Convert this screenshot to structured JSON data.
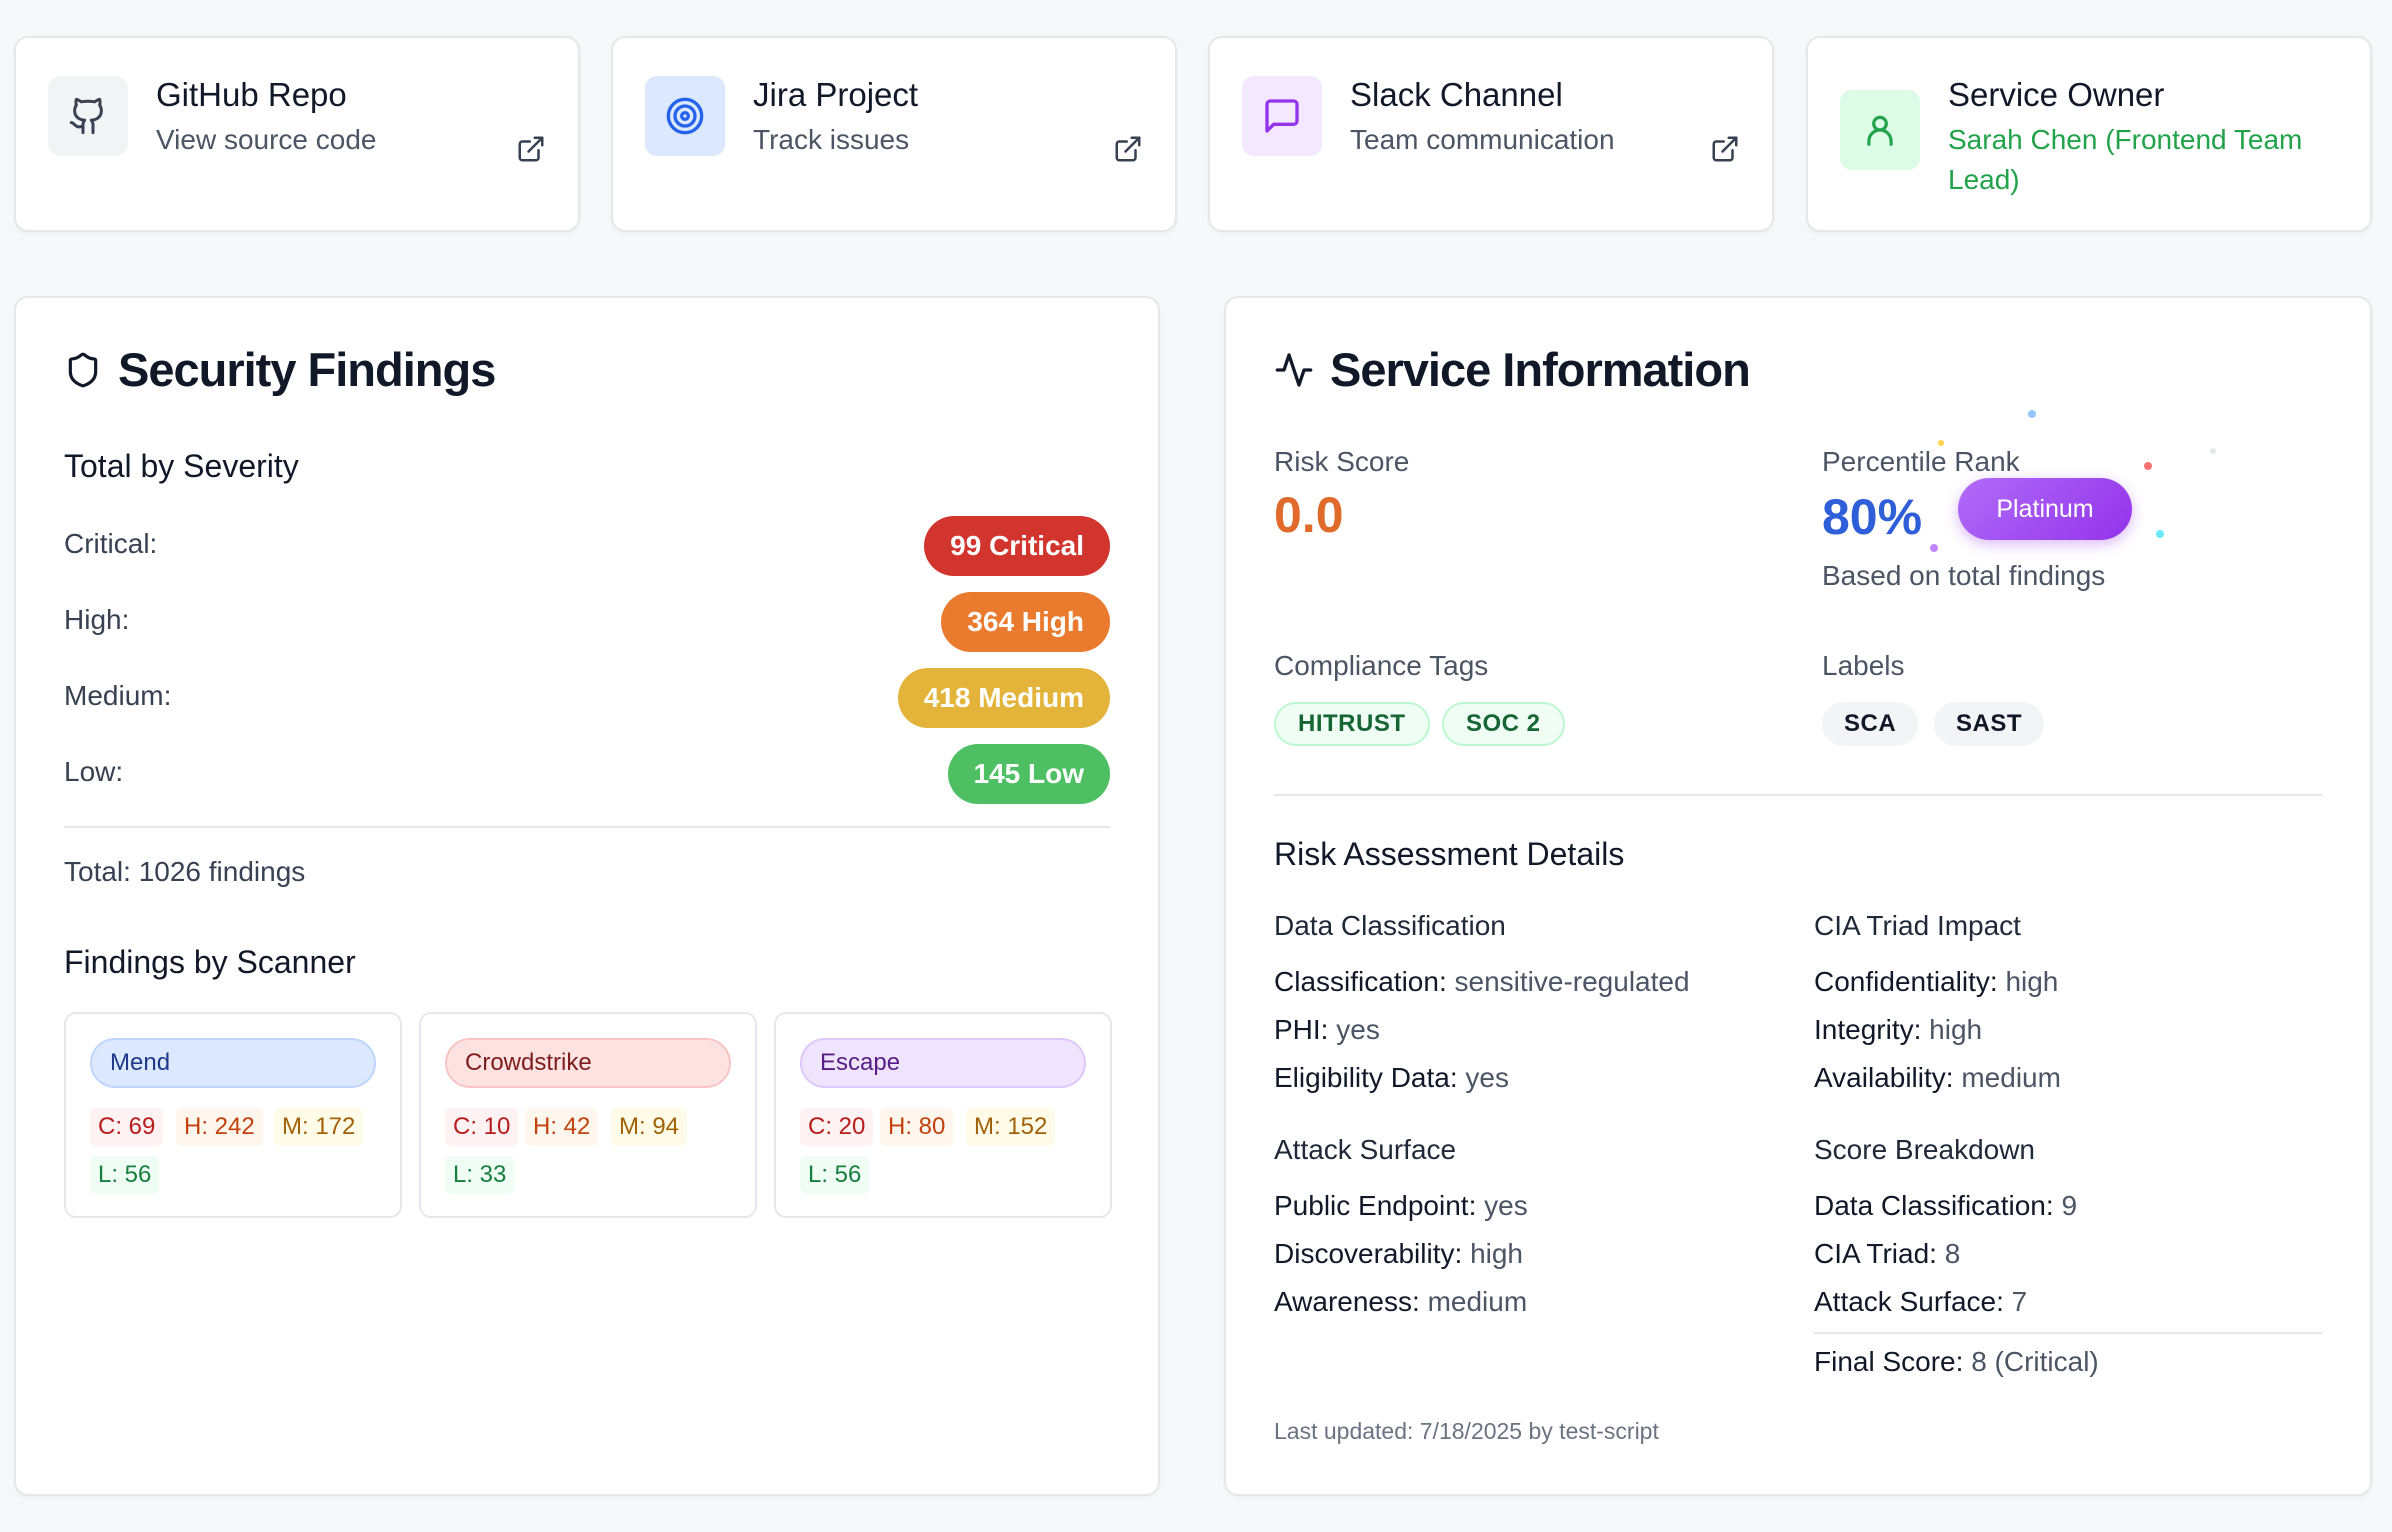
{
  "links": [
    {
      "title": "GitHub Repo",
      "subtitle": "View source code",
      "icon": "github-icon",
      "color": "#374151"
    },
    {
      "title": "Jira Project",
      "subtitle": "Track issues",
      "icon": "target-icon",
      "color": "#2563eb"
    },
    {
      "title": "Slack Channel",
      "subtitle": "Team communication",
      "icon": "message-square-icon",
      "color": "#9333ea"
    }
  ],
  "owner": {
    "title": "Service Owner",
    "name": "Sarah Chen (Frontend Team Lead)"
  },
  "security": {
    "title": "Security Findings",
    "severity_heading": "Total by Severity",
    "rows": [
      {
        "label": "Critical:",
        "badge": "99 Critical",
        "color": "#dc2626"
      },
      {
        "label": "High:",
        "badge": "364 High",
        "color": "#ea7a2e"
      },
      {
        "label": "Medium:",
        "badge": "418 Medium",
        "color": "#e4b43a"
      },
      {
        "label": "Low:",
        "badge": "145 Low",
        "color": "#4fbf63"
      }
    ],
    "total": "Total: 1026 findings",
    "scanner_heading": "Findings by Scanner",
    "scanners": [
      {
        "name": "Mend",
        "c": "C: 69",
        "h": "H: 242",
        "m": "M: 172",
        "l": "L: 56"
      },
      {
        "name": "Crowdstrike",
        "c": "C: 10",
        "h": "H: 42",
        "m": "M: 94",
        "l": "L: 33"
      },
      {
        "name": "Escape",
        "c": "C: 20",
        "h": "H: 80",
        "m": "M: 152",
        "l": "L: 56"
      }
    ]
  },
  "service": {
    "title": "Service Information",
    "risk_label": "Risk Score",
    "risk_value": "0.0",
    "percentile_label": "Percentile Rank",
    "percentile_value": "80%",
    "tier": "Platinum",
    "percentile_note": "Based on total findings",
    "compliance_label": "Compliance Tags",
    "compliance_tags": [
      "HITRUST",
      "SOC 2"
    ],
    "labels_label": "Labels",
    "labels": [
      "SCA",
      "SAST"
    ],
    "risk_heading": "Risk Assessment Details",
    "data_class": {
      "heading": "Data Classification",
      "items": [
        {
          "k": "Classification:",
          "v": "sensitive-regulated"
        },
        {
          "k": "PHI:",
          "v": "yes"
        },
        {
          "k": "Eligibility Data:",
          "v": "yes"
        }
      ]
    },
    "cia": {
      "heading": "CIA Triad Impact",
      "items": [
        {
          "k": "Confidentiality:",
          "v": "high"
        },
        {
          "k": "Integrity:",
          "v": "high"
        },
        {
          "k": "Availability:",
          "v": "medium"
        }
      ]
    },
    "attack": {
      "heading": "Attack Surface",
      "items": [
        {
          "k": "Public Endpoint:",
          "v": "yes"
        },
        {
          "k": "Discoverability:",
          "v": "high"
        },
        {
          "k": "Awareness:",
          "v": "medium"
        }
      ]
    },
    "score": {
      "heading": "Score Breakdown",
      "items": [
        {
          "k": "Data Classification:",
          "v": "9"
        },
        {
          "k": "CIA Triad:",
          "v": "8"
        },
        {
          "k": "Attack Surface:",
          "v": "7"
        }
      ],
      "final_k": "Final Score:",
      "final_v": "8 (Critical)"
    },
    "updated": "Last updated: 7/18/2025 by test-script"
  },
  "colors": {
    "risk": "#e06a2a",
    "percentile": "#2f5fd8",
    "owner": "#22a34a",
    "tier": "#a855f7"
  }
}
